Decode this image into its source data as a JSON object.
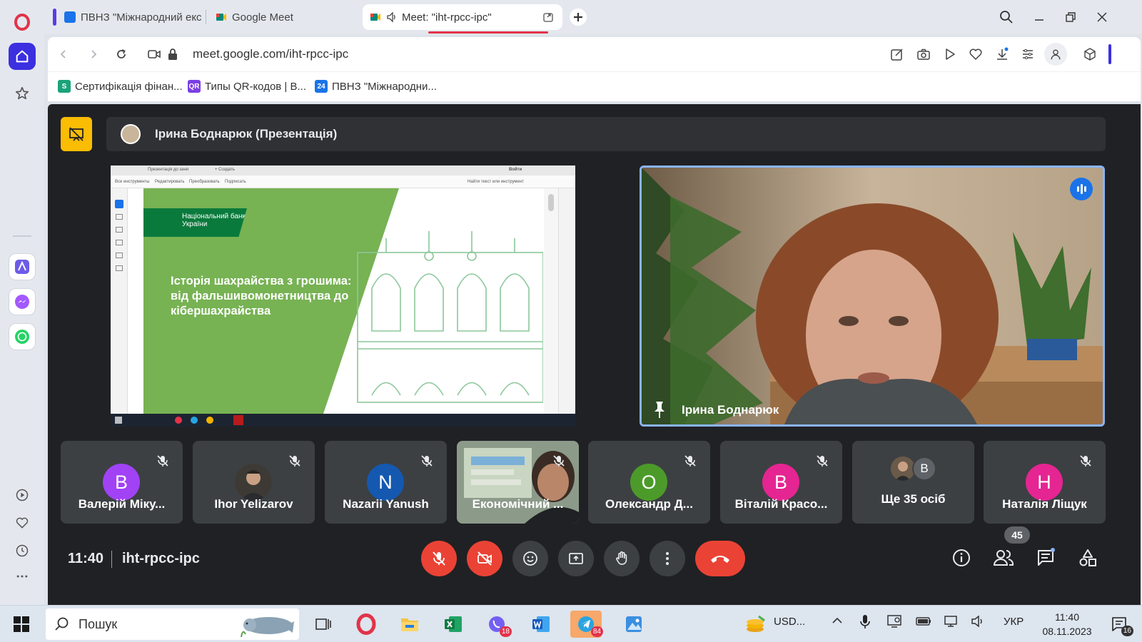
{
  "browser": {
    "tabs": [
      {
        "label": "ПВНЗ \"Міжнародний екс",
        "favicon_color": "#1a73e8"
      },
      {
        "label": "Google Meet",
        "favicon_color": "#00897b"
      },
      {
        "label": "Meet: \"iht-rpcc-ipc\"",
        "favicon_color": "#00897b"
      }
    ],
    "new_tab_label": "+",
    "url": "meet.google.com/iht-rpcc-ipc",
    "bookmarks": [
      {
        "label": "Сертифікація фінан...",
        "icon_color": "#1aa37a"
      },
      {
        "label": "Типы QR-кодов | В...",
        "icon_color": "#7b3fe4"
      },
      {
        "label": "ПВНЗ \"Міжнародни...",
        "icon_color": "#1a73e8"
      }
    ]
  },
  "meet": {
    "presenter_banner": "Ірина Боднарюк (Презентація)",
    "slide": {
      "bank_name": "Національний банк України",
      "title": "Історія шахрайства з грошима: від фальшивомонетництва до кібершахрайства",
      "chrome_tab": "Презентація до заня",
      "chrome_tab2": "+ Создать",
      "chrome_signin": "Войти",
      "menu_items": [
        "Все инструменты",
        "Редактировать",
        "Преобразовать",
        "Подписать"
      ],
      "search_hint": "Найти текст или инструмент"
    },
    "main_speaker": {
      "name": "Ірина Боднарюк"
    },
    "participants": [
      {
        "name": "Валерій Міку...",
        "initial": "В",
        "color": "#a142f4",
        "type": "avatar"
      },
      {
        "name": "Ihor Yelizarov",
        "initial": "",
        "color": "#5a4a3c",
        "type": "photo"
      },
      {
        "name": "Nazarii Yanush",
        "initial": "N",
        "color": "#1558b0",
        "type": "avatar"
      },
      {
        "name": "Економічний ...",
        "initial": "",
        "color": "#6b7a70",
        "type": "video"
      },
      {
        "name": "Олександр Д...",
        "initial": "О",
        "color": "#4c9b2a",
        "type": "avatar"
      },
      {
        "name": "Віталій Красо...",
        "initial": "В",
        "color": "#e52592",
        "type": "avatar"
      },
      {
        "name": "Ще 35 осіб",
        "initial": "В",
        "color": "#5f6368",
        "type": "more"
      },
      {
        "name": "Наталія Ліщук",
        "initial": "Н",
        "color": "#e52592",
        "type": "avatar"
      }
    ],
    "time": "11:40",
    "meeting_code": "iht-rpcc-ipc",
    "participants_count": "45"
  },
  "taskbar": {
    "search_placeholder": "Пошук",
    "viber_badge": "18",
    "telegram_badge": "84",
    "currency": "USD...",
    "language": "УКР",
    "time": "11:40",
    "date": "08.11.2023",
    "notifications": "16"
  }
}
